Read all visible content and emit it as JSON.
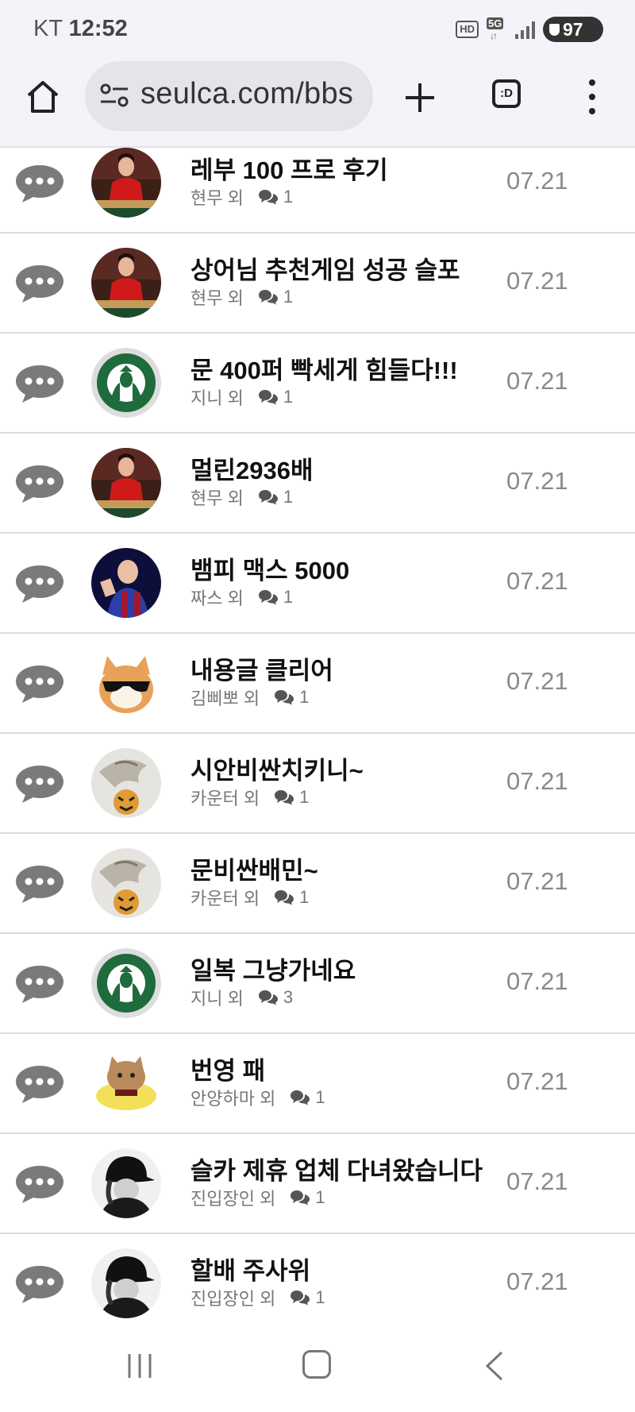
{
  "status_bar": {
    "carrier": "KT",
    "time": "12:52",
    "hd": "HD",
    "network": "5G",
    "battery": "97"
  },
  "browser": {
    "url": "seulca.com/bbs",
    "tabs_icon_text": ":D"
  },
  "posts": [
    {
      "title": "레부 100 프로 후기",
      "author": "현무 외",
      "comments": "1",
      "date": "07.21",
      "avatar": "woman-red-dress"
    },
    {
      "title": "상어님 추천게임 성공 슬포",
      "author": "현무 외",
      "comments": "1",
      "date": "07.21",
      "avatar": "woman-red-dress"
    },
    {
      "title": "문 400퍼 빡세게 힘들다!!!",
      "author": "지니 외",
      "comments": "1",
      "date": "07.21",
      "avatar": "starbucks-logo"
    },
    {
      "title": "멀린2936배",
      "author": "현무 외",
      "comments": "1",
      "date": "07.21",
      "avatar": "woman-red-dress"
    },
    {
      "title": "뱀피 맥스 5000",
      "author": "짜스 외",
      "comments": "1",
      "date": "07.21",
      "avatar": "man-sports-jersey"
    },
    {
      "title": "내용글 클리어",
      "author": "김삐뽀 외",
      "comments": "1",
      "date": "07.21",
      "avatar": "cat-sunglasses"
    },
    {
      "title": "시안비싼치키니~",
      "author": "카운터 외",
      "comments": "1",
      "date": "07.21",
      "avatar": "dragon-tiger"
    },
    {
      "title": "문비싼배민~",
      "author": "카운터 외",
      "comments": "1",
      "date": "07.21",
      "avatar": "dragon-tiger"
    },
    {
      "title": "일복 그냥가네요",
      "author": "지니 외",
      "comments": "3",
      "date": "07.21",
      "avatar": "starbucks-logo"
    },
    {
      "title": "번영 패",
      "author": "안양하마 외",
      "comments": "1",
      "date": "07.21",
      "avatar": "cat-cartoon"
    },
    {
      "title": "슬카 제휴 업체 다녀왔습니다",
      "author": "진입장인 외",
      "comments": "1",
      "date": "07.21",
      "avatar": "person-black-cap"
    },
    {
      "title": "할배 주사위",
      "author": "진입장인 외",
      "comments": "1",
      "date": "07.21",
      "avatar": "person-black-cap"
    }
  ],
  "colors": {
    "chat_icon": "#7a7a7a",
    "date_text": "#8a8a8a",
    "divider": "#dcdcdc",
    "browser_bg": "#f4f3f9"
  }
}
